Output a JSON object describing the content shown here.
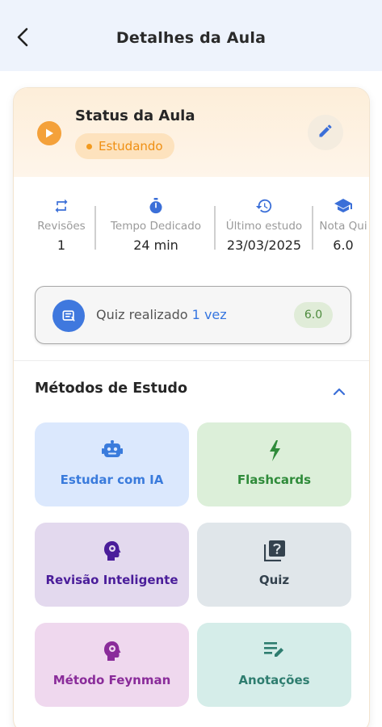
{
  "appbar": {
    "title": "Detalhes da Aula",
    "back_icon": "back-arrow-icon"
  },
  "status": {
    "title": "Status da Aula",
    "badge": "Estudando",
    "icon": "play-circle-icon",
    "edit_icon": "pencil-icon",
    "accent_color": "#f4a13a"
  },
  "stats": [
    {
      "label": "Revisões",
      "value": "1",
      "icon": "repeat-icon"
    },
    {
      "label": "Tempo Dedicado",
      "value": "24 min",
      "icon": "stopwatch-icon"
    },
    {
      "label": "Último estudo",
      "value": "23/03/2025",
      "icon": "history-icon"
    },
    {
      "label": "Nota Qui",
      "value": "6.0",
      "icon": "graduation-cap-icon"
    }
  ],
  "quiz_summary": {
    "text": "Quiz realizado",
    "count": "1 vez",
    "score": "6.0",
    "icon": "quiz-icon"
  },
  "methods_section": {
    "title": "Métodos de Estudo",
    "collapse_icon": "chevron-up-icon",
    "items": [
      {
        "label": "Estudar com IA",
        "icon": "robot-icon",
        "bg": "#dbe8fd",
        "fg": "#3a7bdc"
      },
      {
        "label": "Flashcards",
        "icon": "bolt-icon",
        "bg": "#dcefd9",
        "fg": "#2f8b3a"
      },
      {
        "label": "Revisão Inteligente",
        "icon": "brain-head-icon",
        "bg": "#e3d9ee",
        "fg": "#4a1d9a"
      },
      {
        "label": "Quiz",
        "icon": "quiz-box-icon",
        "bg": "#e0e6ea",
        "fg": "#34424e"
      },
      {
        "label": "Método Feynman",
        "icon": "brain-head-icon",
        "bg": "#efd8ee",
        "fg": "#8a2c9a"
      },
      {
        "label": "Anotações",
        "icon": "notes-edit-icon",
        "bg": "#d5ede9",
        "fg": "#2e7d6f"
      }
    ]
  }
}
